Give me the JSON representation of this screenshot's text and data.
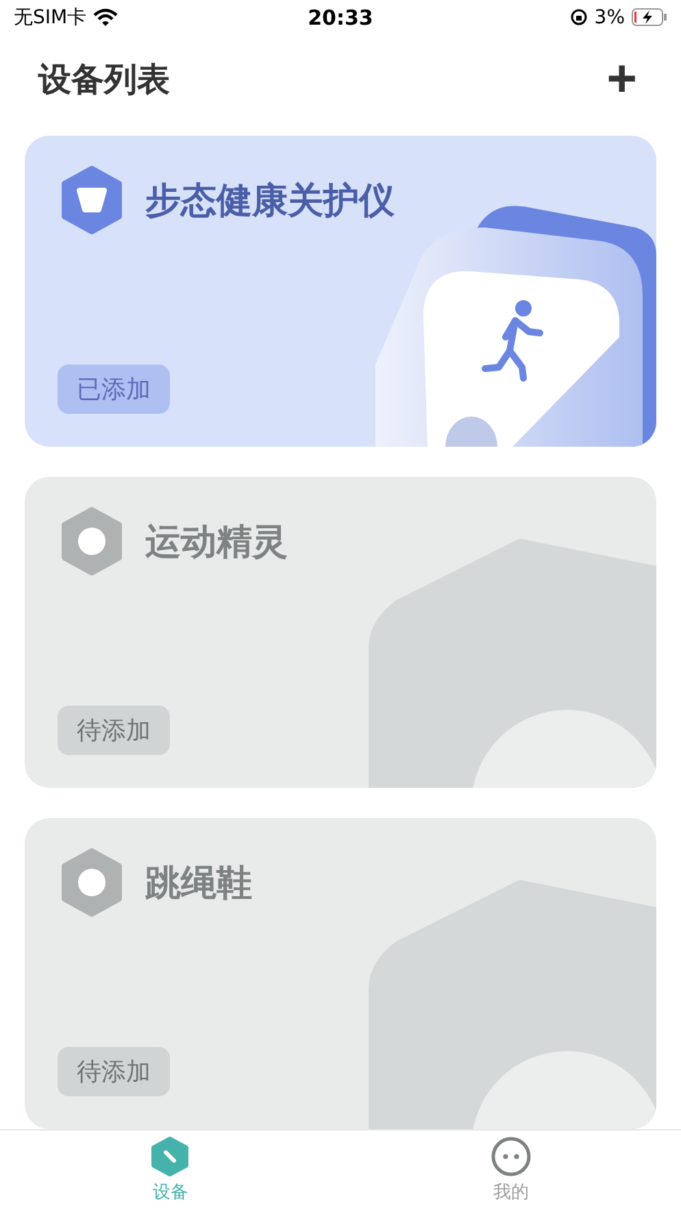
{
  "status_bar": {
    "carrier": "无SIM卡",
    "time": "20:33",
    "battery": "3%"
  },
  "header": {
    "title": "设备列表",
    "add": "+"
  },
  "devices": [
    {
      "name": "步态健康关护仪",
      "status": "已添加",
      "added": true
    },
    {
      "name": "运动精灵",
      "status": "待添加",
      "added": false
    },
    {
      "name": "跳绳鞋",
      "status": "待添加",
      "added": false
    }
  ],
  "tabs": [
    {
      "label": "设备",
      "selected": true
    },
    {
      "label": "我的",
      "selected": false
    }
  ]
}
